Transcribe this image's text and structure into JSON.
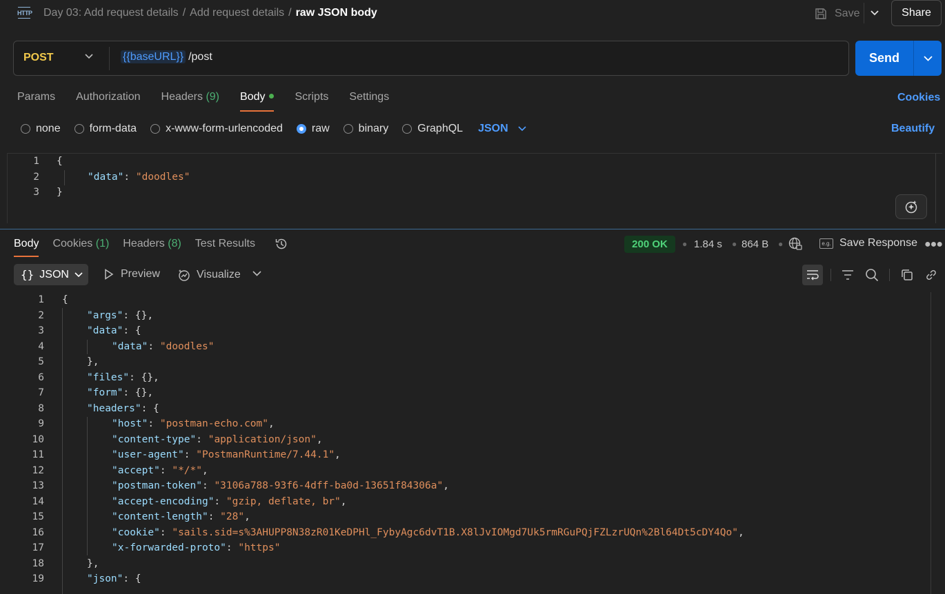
{
  "header": {
    "breadcrumbs": [
      "Day 03: Add request details",
      "Add request details"
    ],
    "current": "raw JSON body",
    "save_label": "Save",
    "share_label": "Share"
  },
  "request": {
    "method": "POST",
    "url_variable": "{{baseURL}}",
    "url_path": "/post",
    "send_label": "Send"
  },
  "request_tabs": [
    {
      "label": "Params",
      "count": ""
    },
    {
      "label": "Authorization",
      "count": ""
    },
    {
      "label": "Headers",
      "count": "(9)"
    },
    {
      "label": "Body",
      "count": ""
    },
    {
      "label": "Scripts",
      "count": ""
    },
    {
      "label": "Settings",
      "count": ""
    }
  ],
  "cookies_label": "Cookies",
  "body_types": [
    "none",
    "form-data",
    "x-www-form-urlencoded",
    "raw",
    "binary",
    "GraphQL"
  ],
  "selected_body_type": "raw",
  "raw_format": "JSON",
  "beautify_label": "Beautify",
  "request_body_lines": [
    "{",
    "\"data\": \"doodles\"",
    "}"
  ],
  "response_tabs": [
    {
      "label": "Body",
      "count": ""
    },
    {
      "label": "Cookies",
      "count": "(1)"
    },
    {
      "label": "Headers",
      "count": "(8)"
    },
    {
      "label": "Test Results",
      "count": ""
    }
  ],
  "response_meta": {
    "status": "200 OK",
    "time": "1.84 s",
    "size": "864 B",
    "save_response_label": "Save Response"
  },
  "response_toolbar": {
    "format": "JSON",
    "preview_label": "Preview",
    "visualize_label": "Visualize"
  },
  "response_body": {
    "args": "{}",
    "data_value": "doodles",
    "files": "{}",
    "form": "{}",
    "headers": [
      {
        "key": "host",
        "value": "postman-echo.com"
      },
      {
        "key": "content-type",
        "value": "application/json"
      },
      {
        "key": "user-agent",
        "value": "PostmanRuntime/7.44.1"
      },
      {
        "key": "accept",
        "value": "*/*"
      },
      {
        "key": "postman-token",
        "value": "3106a788-93f6-4dff-ba0d-13651f84306a"
      },
      {
        "key": "accept-encoding",
        "value": "gzip, deflate, br"
      },
      {
        "key": "content-length",
        "value": "28"
      },
      {
        "key": "cookie",
        "value": "sails.sid=s%3AHUPP8N38zR01KeDPHl_FybyAgc6dvT1B.X8lJvIOMgd7Uk5rmRGuPQjFZLzrUQn%2Bl64Dt5cDY4Qo"
      },
      {
        "key": "x-forwarded-proto",
        "value": "https"
      }
    ]
  },
  "colors": {
    "accent": "#0c6ad9",
    "method": "#f2c94c",
    "status_ok": "#4fd37a",
    "active_tab": "#e8733b",
    "link": "#4e9cff"
  }
}
